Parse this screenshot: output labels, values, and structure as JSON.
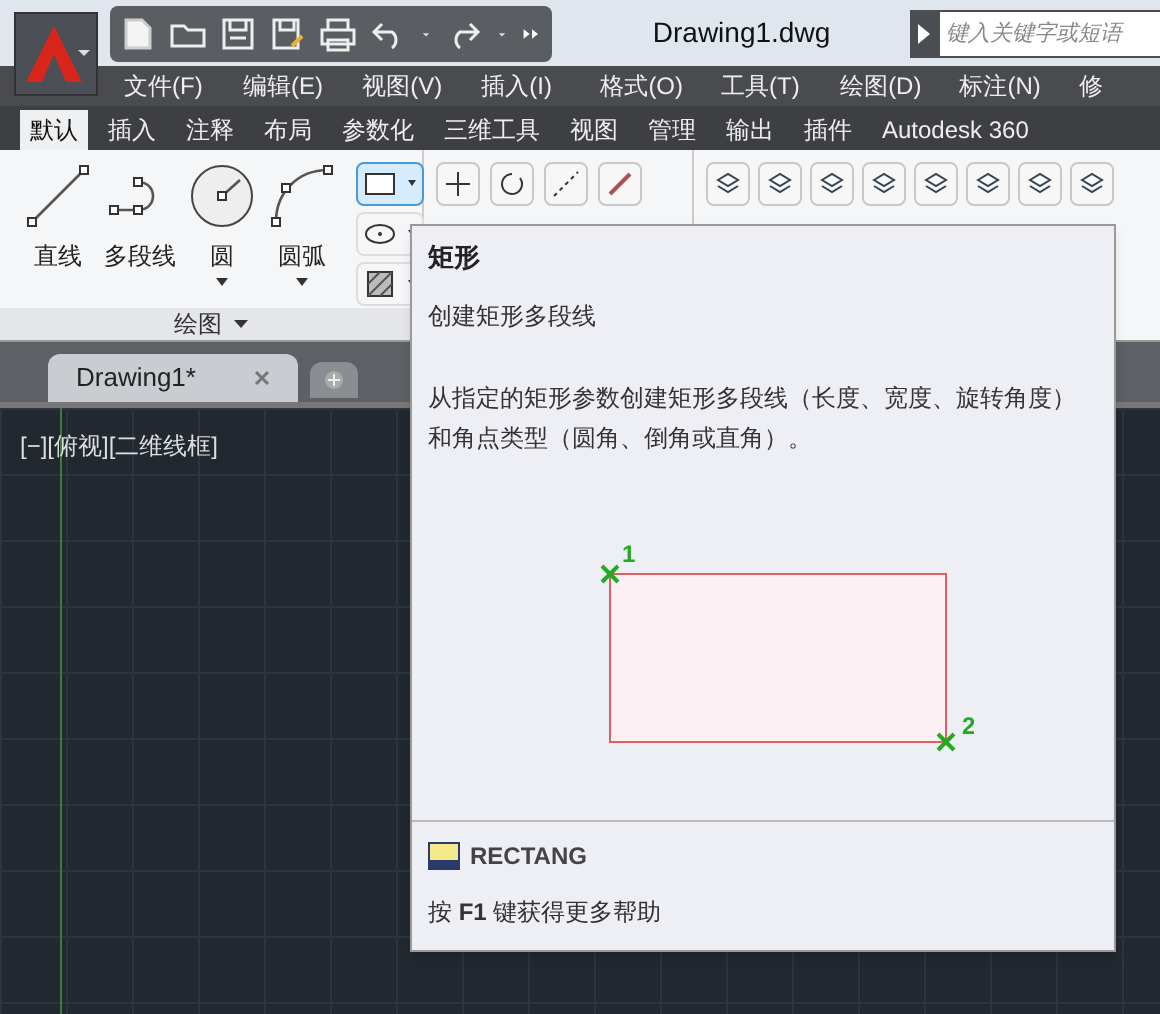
{
  "title_bar": {
    "title": "Drawing1.dwg",
    "search": {
      "placeholder": "键入关键字或短语"
    }
  },
  "menu_bar": [
    "文件(F)",
    "编辑(E)",
    "视图(V)",
    "插入(I)",
    "格式(O)",
    "工具(T)",
    "绘图(D)",
    "标注(N)",
    "修"
  ],
  "ribbon_tabs": [
    {
      "label": "默认",
      "selected": true
    },
    {
      "label": "插入",
      "selected": false
    },
    {
      "label": "注释",
      "selected": false
    },
    {
      "label": "布局",
      "selected": false
    },
    {
      "label": "参数化",
      "selected": false
    },
    {
      "label": "三维工具",
      "selected": false
    },
    {
      "label": "视图",
      "selected": false
    },
    {
      "label": "管理",
      "selected": false
    },
    {
      "label": "输出",
      "selected": false
    },
    {
      "label": "插件",
      "selected": false
    },
    {
      "label": "Autodesk 360",
      "selected": false
    }
  ],
  "draw_panel": {
    "title": "绘图",
    "tools": [
      {
        "label": "直线",
        "kind": "line",
        "dropdown": false
      },
      {
        "label": "多段线",
        "kind": "polyline",
        "dropdown": false
      },
      {
        "label": "圆",
        "kind": "circle",
        "dropdown": true
      },
      {
        "label": "圆弧",
        "kind": "arc",
        "dropdown": true
      }
    ],
    "small_tools": [
      {
        "kind": "rectangle",
        "selected": true
      },
      {
        "kind": "ellipse",
        "selected": false
      },
      {
        "kind": "hatch",
        "selected": false
      }
    ]
  },
  "doc_tabs": [
    {
      "label": "Drawing1*",
      "selected": true
    }
  ],
  "viewport": {
    "label": "[−][俯视][二维线框]"
  },
  "tooltip": {
    "title": "矩形",
    "subtitle": "创建矩形多段线",
    "description": "从指定的矩形参数创建矩形多段线（长度、宽度、旋转角度）和角点类型（圆角、倒角或直角）。",
    "diagram": {
      "point_1": "1",
      "point_2": "2"
    },
    "command": "RECTANG",
    "help": "按 **F1** 键获得更多帮助"
  }
}
